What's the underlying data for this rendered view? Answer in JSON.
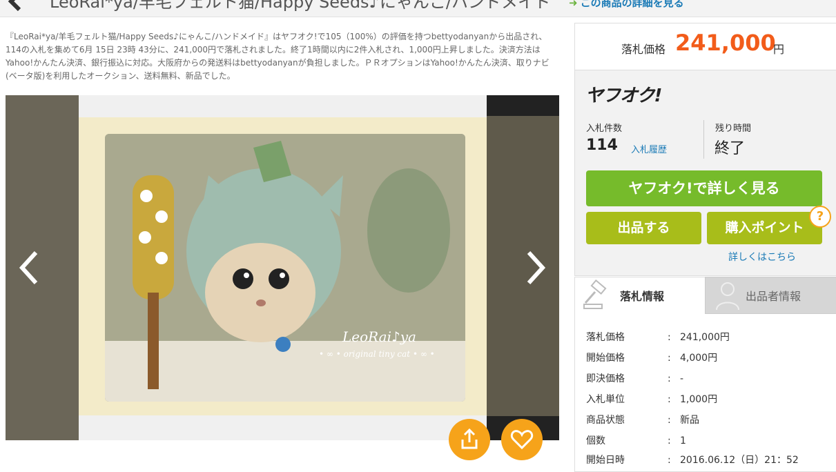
{
  "header": {
    "title": "LeoRai*ya/羊毛フェルト猫/Happy Seeds♪にゃんこ/ハンドメイド",
    "detail_link": "この商品の詳細を見る"
  },
  "description": "『LeoRai*ya/羊毛フェルト猫/Happy Seeds♪にゃんこ/ハンドメイド』はヤフオク!で105（100%）の評価を持つbettyodanyanから出品され、114の入札を集めて6月 15日 23時 43分に、241,000円で落札されました。終了1時間以内に2件入札され、1,000円上昇しました。決済方法はYahoo!かんたん決済、銀行振込に対応。大阪府からの発送料はbettyodanyanが負担しました。ＰＲオプションはYahoo!かんたん決済、取りナビ(ベータ版)を利用したオークション、送料無料、新品でした。",
  "gallery": {
    "watermark_brand": "LeoRai♪ya",
    "watermark_sub": "• ∞ • original tiny cat • ∞ •"
  },
  "price": {
    "label": "落札価格",
    "value": "241,000",
    "unit": "円"
  },
  "auction": {
    "logo": "ヤフオク!",
    "bids_label": "入札件数",
    "bids_count": "114",
    "bid_history": "入札履歴",
    "time_label": "残り時間",
    "time_value": "終了",
    "view_button": "ヤフオク!で詳しく見る",
    "sell_button": "出品する",
    "points_button": "購入ポイント",
    "help_badge": "?",
    "more_link": "詳しくはこちら"
  },
  "tabs": [
    {
      "label": "落札情報",
      "icon": "gavel-icon"
    },
    {
      "label": "出品者情報",
      "icon": "user-icon"
    }
  ],
  "info_rows": [
    {
      "key": "落札価格",
      "value": "241,000円"
    },
    {
      "key": "開始価格",
      "value": "4,000円"
    },
    {
      "key": "即決価格",
      "value": "-"
    },
    {
      "key": "入札単位",
      "value": "1,000円"
    },
    {
      "key": "商品状態",
      "value": "新品"
    },
    {
      "key": "個数",
      "value": "1"
    },
    {
      "key": "開始日時",
      "value": "2016.06.12（日）21：52"
    }
  ],
  "colors": {
    "accent_orange": "#f25c1a",
    "button_green": "#76bb2b",
    "button_olive": "#a8bd1a",
    "fab_orange": "#f6a31a",
    "link_blue": "#1a7ab6"
  }
}
